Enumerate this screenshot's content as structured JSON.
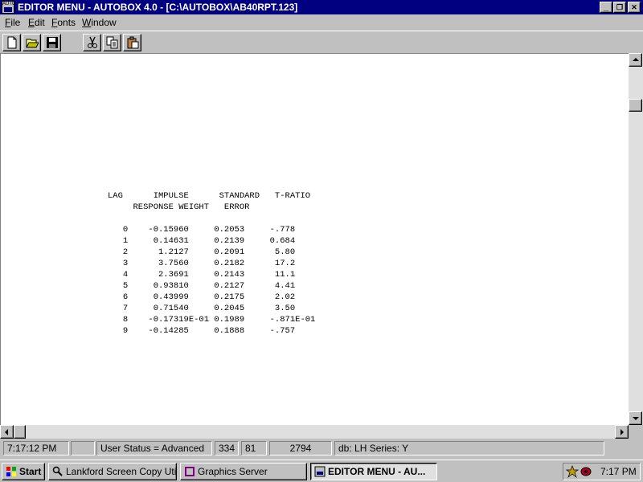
{
  "window": {
    "title": "EDITOR MENU - AUTOBOX 4.0 - [C:\\AUTOBOX\\AB40RPT.123]",
    "icon_text": "AUTO",
    "controls": {
      "minimize": "_",
      "restore": "❐",
      "close": "✕"
    }
  },
  "menu": {
    "items": [
      {
        "key": "F",
        "rest": "ile"
      },
      {
        "key": "E",
        "rest": "dit"
      },
      {
        "key": "F",
        "rest": "onts"
      },
      {
        "key": "W",
        "rest": "indow"
      }
    ]
  },
  "toolbar": {
    "buttons": [
      "new-file-icon",
      "open-folder-icon",
      "save-disk-icon",
      "cut-scissors-icon",
      "copy-icon",
      "paste-icon"
    ]
  },
  "report": {
    "header1": "LAG      IMPULSE      STANDARD   T-RATIO",
    "header2": "     RESPONSE WEIGHT   ERROR",
    "rows": [
      "   0    -0.15960     0.2053     -.778",
      "   1     0.14631     0.2139     0.684",
      "   2      1.2127     0.2091      5.80",
      "   3      3.7560     0.2182      17.2",
      "   4      2.3691     0.2143      11.1",
      "   5     0.93810     0.2127      4.41",
      "   6     0.43999     0.2175      2.02",
      "   7     0.71540     0.2045      3.50",
      "   8    -0.17319E-01 0.1989     -.871E-01",
      "   9    -0.14285     0.1888     -.757"
    ]
  },
  "status": {
    "time": "7:17:12 PM",
    "blank": "",
    "user_status": "User Status = Advanced",
    "col": "334",
    "line": "81",
    "total": "2794",
    "db": "db: LH Series: Y"
  },
  "taskbar": {
    "start": "Start",
    "tasks": [
      {
        "label": "Lankford Screen Copy Utility",
        "active": false
      },
      {
        "label": "Graphics Server",
        "active": false
      },
      {
        "label": "EDITOR MENU - AU...",
        "active": true
      }
    ],
    "clock": "7:17 PM"
  },
  "colors": {
    "titlebar": "#000080",
    "face": "#c0c0c0",
    "editor_bg": "#ffffff"
  }
}
